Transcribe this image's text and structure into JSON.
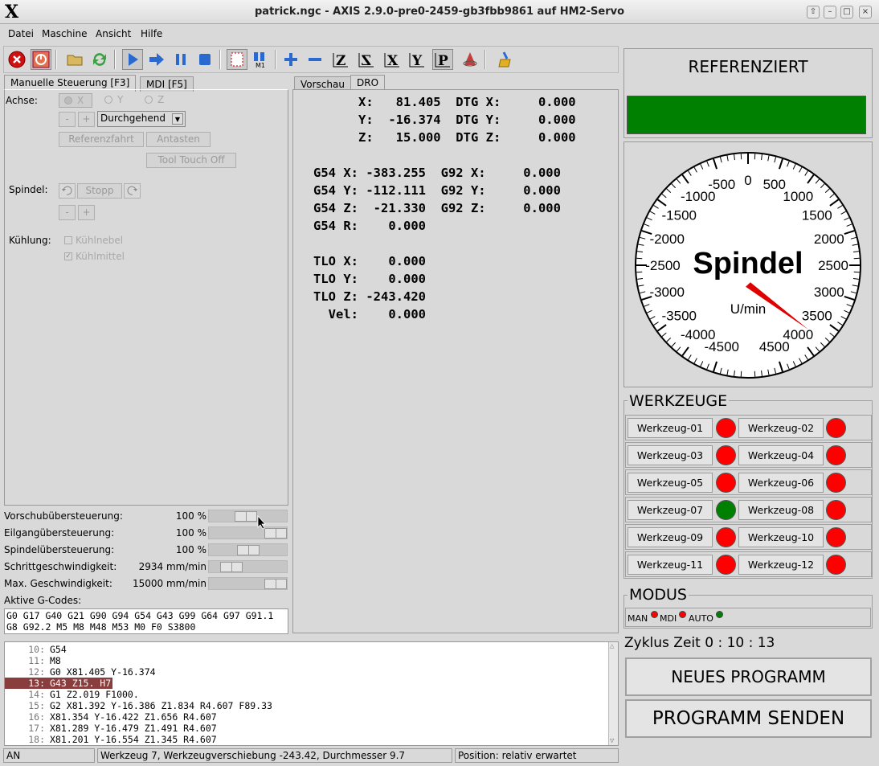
{
  "window": {
    "title": "patrick.ngc - AXIS 2.9.0-pre0-2459-gb3fbb9861 auf  HM2-Servo",
    "logo": "X"
  },
  "menu": [
    "Datei",
    "Maschine",
    "Ansicht",
    "Hilfe"
  ],
  "tabs_left": {
    "manual": "Manuelle Steuerung [F3]",
    "mdi": "MDI [F5]"
  },
  "tabs_right": {
    "preview": "Vorschau",
    "dro": "DRO"
  },
  "manual": {
    "axis_label": "Achse:",
    "axes": [
      "X",
      "Y",
      "Z"
    ],
    "minus": "-",
    "plus": "+",
    "jog_mode": "Durchgehend",
    "home_button": "Referenzfahrt",
    "touch_button": "Antasten",
    "tool_touch_off": "Tool Touch Off",
    "spindle_label": "Spindel:",
    "spindle_stop": "Stopp",
    "cooling_label": "Kühlung:",
    "mist": "Kühlnebel",
    "flood": "Kühlmittel"
  },
  "overrides": [
    {
      "label": "Vorschubübersteuerung:",
      "value": "100 %",
      "level": 0.47
    },
    {
      "label": "Eilgangübersteuerung:",
      "value": "100 %",
      "level": 1.0
    },
    {
      "label": "Spindelübersteuerung:",
      "value": "100 %",
      "level": 0.5
    },
    {
      "label": "Schrittgeschwindigkeit:",
      "value": "2934 mm/min",
      "level": 0.2
    },
    {
      "label": "Max. Geschwindigkeit:",
      "value": "15000 mm/min",
      "level": 1.0
    }
  ],
  "gcodes": {
    "label": "Aktive G-Codes:",
    "line1": "G0 G17 G40 G21 G90 G94 G54 G43 G99 G64 G97 G91.1",
    "line2": "G8 G92.2 M5 M8 M48 M53 M0 F0 S3800"
  },
  "dro": [
    "      X:   81.405  DTG X:     0.000",
    "      Y:  -16.374  DTG Y:     0.000",
    "      Z:   15.000  DTG Z:     0.000",
    "",
    "G54 X: -383.255  G92 X:     0.000",
    "G54 Y: -112.111  G92 Y:     0.000",
    "G54 Z:  -21.330  G92 Z:     0.000",
    "G54 R:    0.000",
    "",
    "TLO X:    0.000",
    "TLO Y:    0.000",
    "TLO Z: -243.420",
    "  Vel:    0.000"
  ],
  "code": [
    {
      "n": "10:",
      "t": "G54"
    },
    {
      "n": "11:",
      "t": "M8"
    },
    {
      "n": "12:",
      "t": "G0 X81.405 Y-16.374"
    },
    {
      "n": "13:",
      "t": "G43 Z15. H7"
    },
    {
      "n": "14:",
      "t": "G1 Z2.019 F1000."
    },
    {
      "n": "15:",
      "t": "G2 X81.392 Y-16.386 Z1.834 R4.607 F89.33"
    },
    {
      "n": "16:",
      "t": "X81.354 Y-16.422 Z1.656 R4.607"
    },
    {
      "n": "17:",
      "t": "X81.289 Y-16.479 Z1.491 R4.607"
    },
    {
      "n": "18:",
      "t": "X81.201 Y-16.554 Z1.345 R4.607"
    }
  ],
  "selected_line_index": 3,
  "statusbar": {
    "mode": "AN",
    "tool": "Werkzeug 7, Werkzeugverschiebung -243.42, Durchmesser 9.7",
    "position": "Position: relativ erwartet"
  },
  "right": {
    "homed_label": "REFERENZIERT",
    "homed_color": "#008000",
    "gauge": {
      "title": "Spindel",
      "unit": "U/min",
      "ticks": [
        "0",
        "500",
        "1000",
        "1500",
        "2000",
        "2500",
        "3000",
        "3500",
        "4000",
        "4500",
        "-500",
        "-1000",
        "-1500",
        "-2000",
        "-2500",
        "-3000",
        "-3500",
        "-4000",
        "-4500"
      ],
      "value": 3800
    },
    "tools_title": "WERKZEUGE",
    "tools": [
      {
        "name": "Werkzeug-01",
        "color": "#ff0000"
      },
      {
        "name": "Werkzeug-02",
        "color": "#ff0000"
      },
      {
        "name": "Werkzeug-03",
        "color": "#ff0000"
      },
      {
        "name": "Werkzeug-04",
        "color": "#ff0000"
      },
      {
        "name": "Werkzeug-05",
        "color": "#ff0000"
      },
      {
        "name": "Werkzeug-06",
        "color": "#ff0000"
      },
      {
        "name": "Werkzeug-07",
        "color": "#008000"
      },
      {
        "name": "Werkzeug-08",
        "color": "#ff0000"
      },
      {
        "name": "Werkzeug-09",
        "color": "#ff0000"
      },
      {
        "name": "Werkzeug-10",
        "color": "#ff0000"
      },
      {
        "name": "Werkzeug-11",
        "color": "#ff0000"
      },
      {
        "name": "Werkzeug-12",
        "color": "#ff0000"
      }
    ],
    "modus_title": "MODUS",
    "modus": [
      {
        "name": "MAN",
        "color": "#ff0000"
      },
      {
        "name": "MDI",
        "color": "#ff0000"
      },
      {
        "name": "AUTO",
        "color": "#008000"
      }
    ],
    "cycle_label": "Zyklus Zeit",
    "cycle_time": "0 : 10 : 13",
    "new_program": "NEUES PROGRAMM",
    "send_program": "PROGRAMM SENDEN"
  }
}
